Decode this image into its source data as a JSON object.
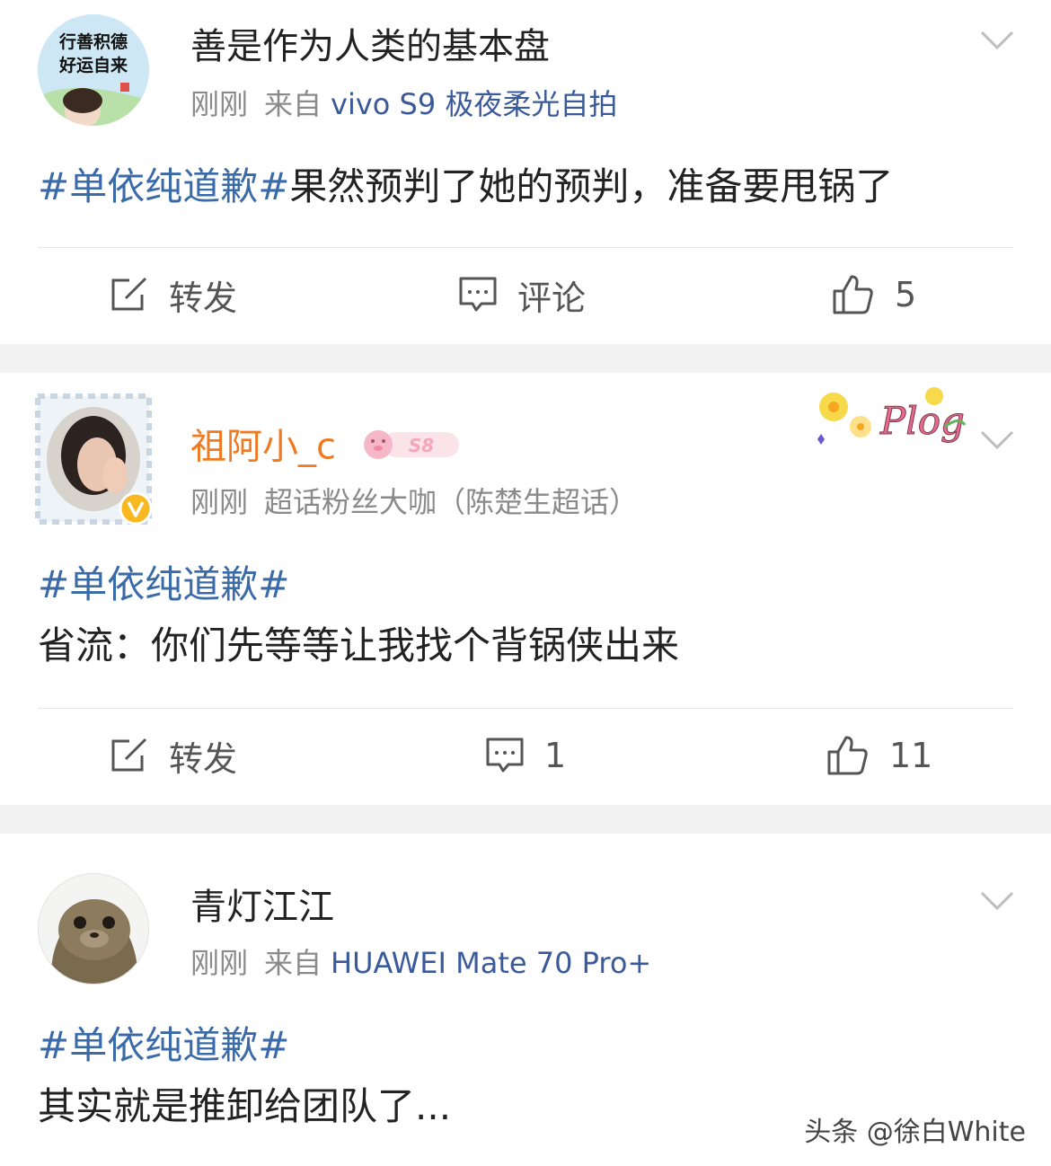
{
  "posts": [
    {
      "user": "善是作为人类的基本盘",
      "time": "刚刚",
      "source_prefix": "来自",
      "device": "vivo S9 极夜柔光自拍",
      "topic": "#单依纯道歉#",
      "text": "果然预判了她的预判，准备要甩锅了",
      "avatar_text": [
        "行善积德",
        "好运自来"
      ],
      "repost": "转发",
      "comment": "评论",
      "likes": "5"
    },
    {
      "user": "祖阿小_c",
      "level_badge": "S8",
      "time": "刚刚",
      "fan_title": "超话粉丝大咖（陈楚生超话）",
      "sticker": "Plog",
      "topic": "#单依纯道歉#",
      "text": "省流：你们先等等让我找个背锅侠出来",
      "repost": "转发",
      "comment": "1",
      "likes": "11"
    },
    {
      "user": "青灯江江",
      "time": "刚刚",
      "source_prefix": "来自",
      "device": "HUAWEI Mate 70 Pro+",
      "topic": "#单依纯道歉#",
      "text": "其实就是推卸给团队了..."
    }
  ],
  "watermark": "头条 @徐白White",
  "colors": {
    "topic": "#3b6aa8",
    "orange_name": "#f07a22",
    "device": "#3b5a9a",
    "gray": "#8a8a8a",
    "gap": "#f2f2f2"
  }
}
